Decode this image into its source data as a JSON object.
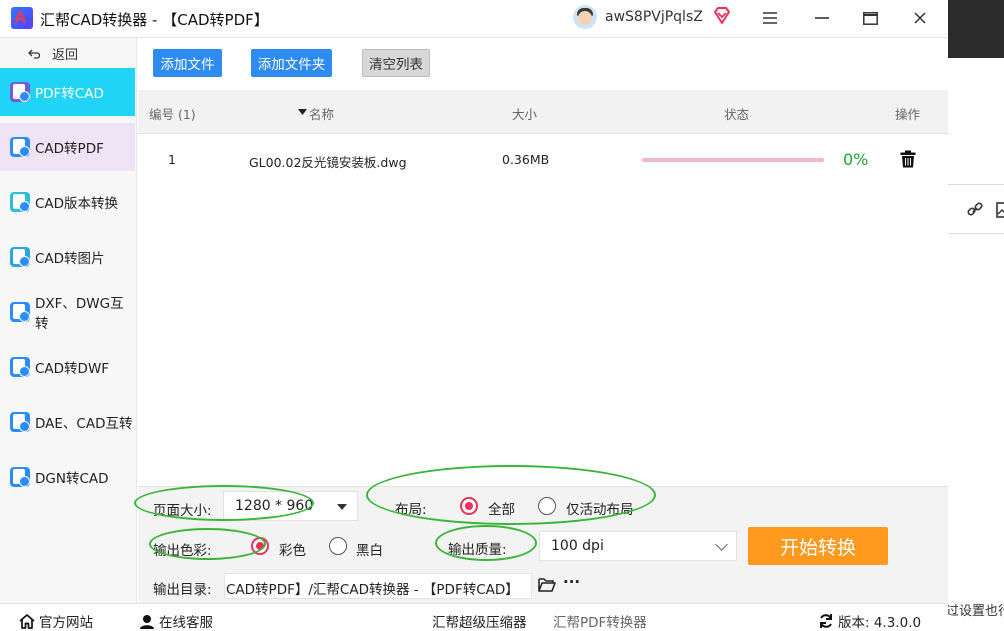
{
  "titlebar": {
    "title": "汇帮CAD转换器 - 【CAD转PDF】",
    "username": "awS8PVjPqlsZ",
    "menu_icon": "hamburger-icon",
    "minimize_icon": "minimize-icon",
    "maximize_icon": "maximize-icon",
    "close_icon": "close-icon"
  },
  "sidebar": {
    "back_label": "返回",
    "items": [
      {
        "label": "PDF转CAD",
        "state": "active"
      },
      {
        "label": "CAD转PDF",
        "state": "selected"
      },
      {
        "label": "CAD版本转换"
      },
      {
        "label": "CAD转图片"
      },
      {
        "label": "DXF、DWG互转"
      },
      {
        "label": "CAD转DWF"
      },
      {
        "label": "DAE、CAD互转"
      },
      {
        "label": "DGN转CAD"
      }
    ]
  },
  "toolbar": {
    "add_file": "添加文件",
    "add_folder": "添加文件夹",
    "clear_list": "清空列表"
  },
  "table": {
    "headers": {
      "number": "编号 (1)",
      "name": "名称",
      "size": "大小",
      "status": "状态",
      "action": "操作"
    },
    "rows": [
      {
        "number": "1",
        "name": "GL00.02反光镜安装板.dwg",
        "size": "0.36MB",
        "progress": 0,
        "percent": "0%"
      }
    ]
  },
  "settings": {
    "page_size_label": "页面大小:",
    "page_size_value": "1280 * 960",
    "layout_label": "布局:",
    "layout_options": [
      "全部",
      "仅活动布局"
    ],
    "layout_selected": "全部",
    "color_label": "输出色彩:",
    "color_options": [
      "彩色",
      "黑白"
    ],
    "color_selected": "彩色",
    "quality_label": "输出质量:",
    "quality_value": "100 dpi",
    "start_button": "开始转换",
    "output_dir_label": "输出目录:",
    "output_dir_value": "CAD转PDF】/汇帮CAD转换器 - 【PDF转CAD】",
    "more_label": "···"
  },
  "bottombar": {
    "website": "官方网站",
    "service": "在线客服",
    "compressor": "汇帮超级压缩器",
    "pdf_converter": "汇帮PDF转换器",
    "version": "版本:  4.3.0.0"
  },
  "background": {
    "cut_text": "过设置也行"
  },
  "colors": {
    "accent_cyan": "#20d4f7",
    "button_blue": "#2e8bf0",
    "start_orange": "#ff9a1f",
    "radio_red": "#e8315b",
    "progress_pink": "#f3b8c6",
    "percent_green": "#1ea335",
    "annotation_green": "#3ab53a"
  }
}
